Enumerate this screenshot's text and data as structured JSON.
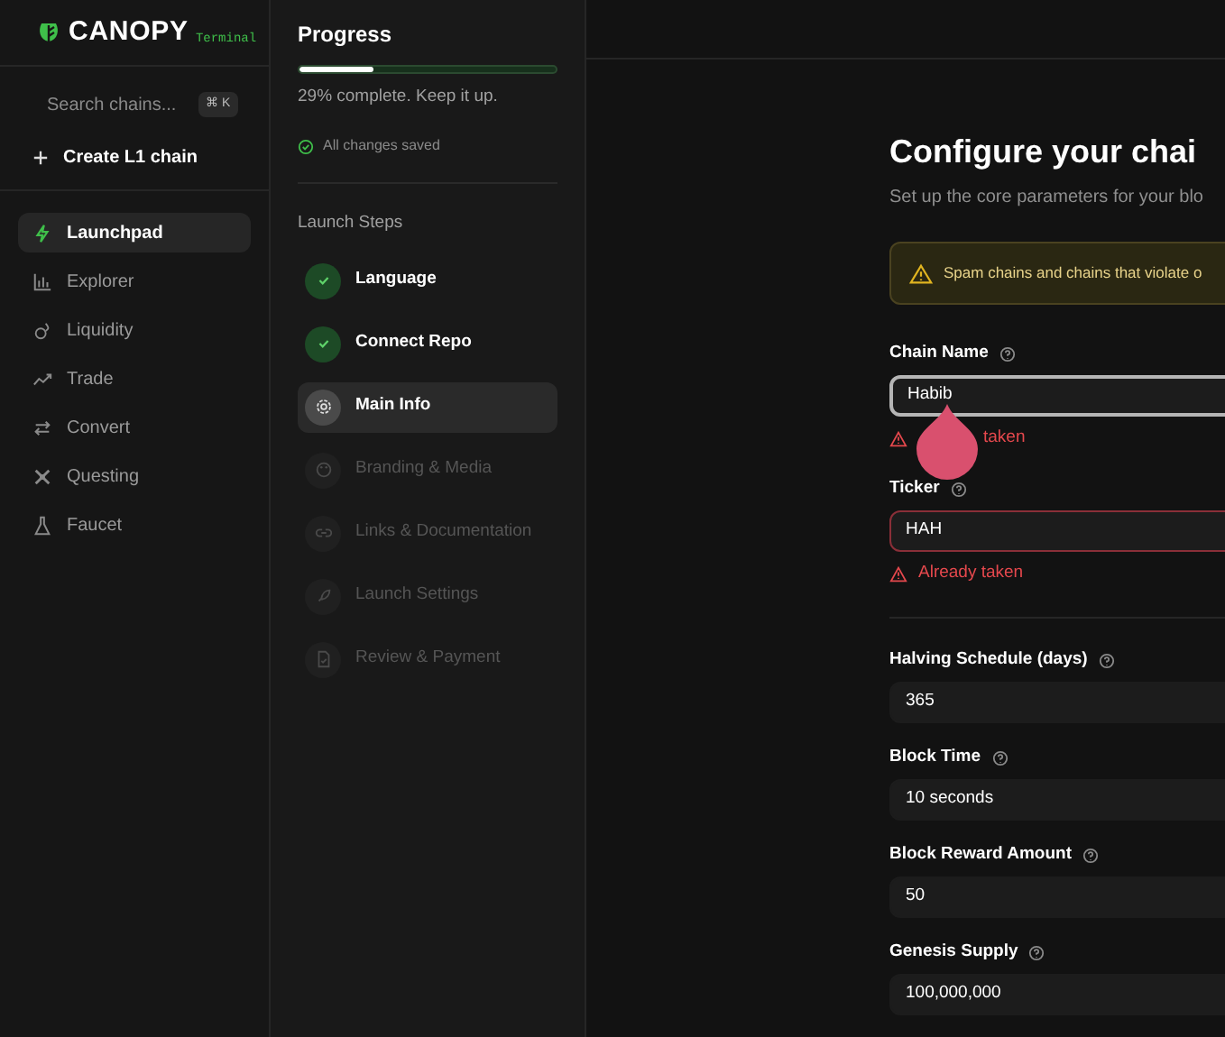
{
  "brand": {
    "name": "CANOPY",
    "tag": "Terminal"
  },
  "search": {
    "placeholder": "Search chains...",
    "shortcut": "⌘ K"
  },
  "create_button": "Create L1 chain",
  "nav": [
    {
      "label": "Launchpad",
      "selected": true
    },
    {
      "label": "Explorer",
      "selected": false
    },
    {
      "label": "Liquidity",
      "selected": false
    },
    {
      "label": "Trade",
      "selected": false
    },
    {
      "label": "Convert",
      "selected": false
    },
    {
      "label": "Questing",
      "selected": false
    },
    {
      "label": "Faucet",
      "selected": false
    }
  ],
  "progress": {
    "title": "Progress",
    "level": 0.29,
    "text": "29% complete. Keep it up.",
    "saved": "All changes saved"
  },
  "steps": {
    "title": "Launch Steps",
    "items": [
      {
        "label": "Language",
        "done": true,
        "selected": false,
        "disabled": false
      },
      {
        "label": "Connect Repo",
        "done": true,
        "selected": false,
        "disabled": false
      },
      {
        "label": "Main Info",
        "done": false,
        "selected": true,
        "disabled": false
      },
      {
        "label": "Branding & Media",
        "done": false,
        "selected": false,
        "disabled": true
      },
      {
        "label": "Links & Documentation",
        "done": false,
        "selected": false,
        "disabled": true
      },
      {
        "label": "Launch Settings",
        "done": false,
        "selected": false,
        "disabled": true
      },
      {
        "label": "Review & Payment",
        "done": false,
        "selected": false,
        "disabled": true
      }
    ]
  },
  "form": {
    "title": "Configure your chai",
    "subtitle": "Set up the core parameters for your blo",
    "warning": "Spam chains and chains that violate o",
    "identity_fields": [
      {
        "label": "Chain Name",
        "value": "Habib",
        "focused": true,
        "error": "taken"
      },
      {
        "label": "Ticker",
        "value": "HAH",
        "focused": false,
        "invalid": true,
        "error": "Already taken"
      }
    ],
    "economics_fields": [
      {
        "label": "Halving Schedule (days)",
        "value": "365"
      },
      {
        "label": "Block Time",
        "value": "10 seconds"
      },
      {
        "label": "Block Reward Amount",
        "value": "50"
      },
      {
        "label": "Genesis Supply",
        "value": "100,000,000"
      }
    ]
  }
}
